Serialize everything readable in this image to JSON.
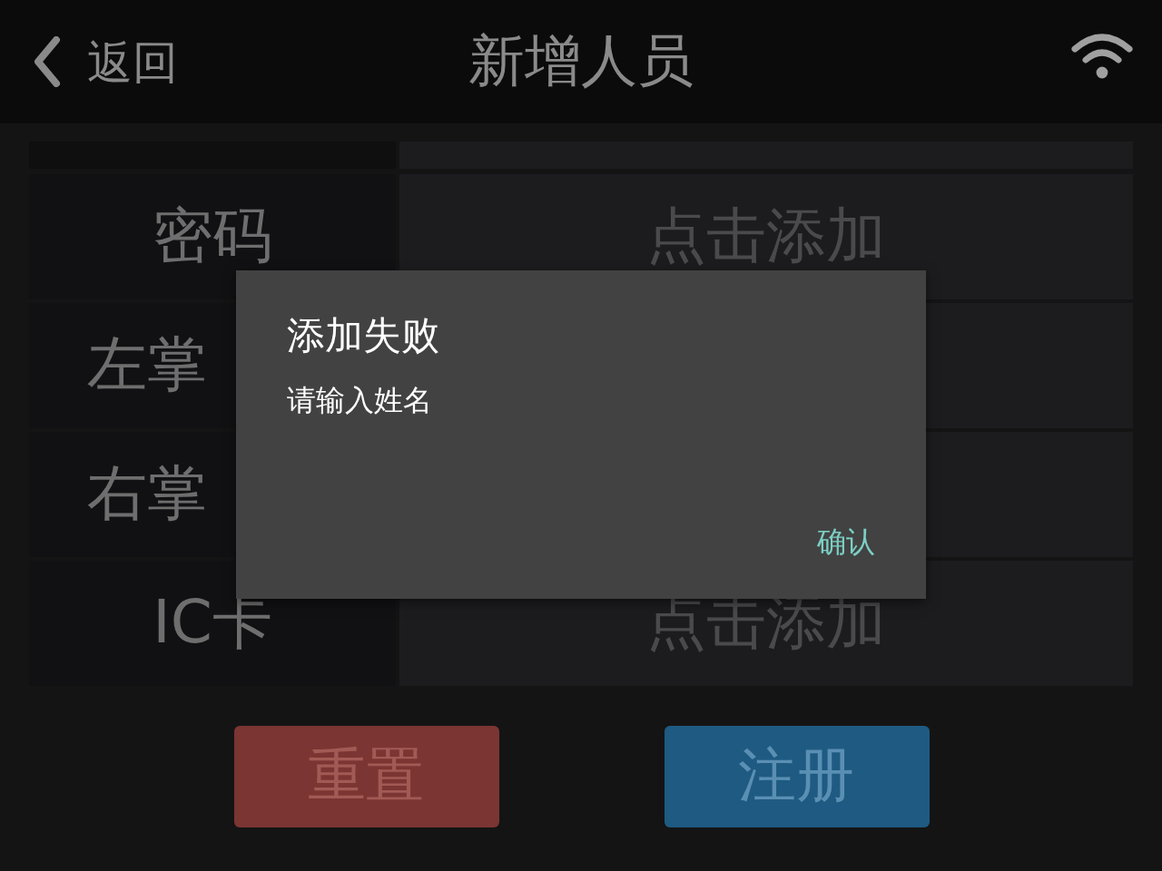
{
  "top_bar": {
    "back_label": "返回",
    "title": "新增人员"
  },
  "rows": [
    {
      "label": "密码",
      "value": "点击添加"
    },
    {
      "label": "左掌"
    },
    {
      "label": "右掌"
    },
    {
      "label": "IC卡",
      "value": "点击添加"
    }
  ],
  "buttons": [
    {
      "label": "重置",
      "kind": "reset"
    },
    {
      "label": "注册",
      "kind": "register"
    }
  ],
  "dialog": {
    "title": "添加失败",
    "message": "请输入姓名",
    "confirm": "确认"
  }
}
